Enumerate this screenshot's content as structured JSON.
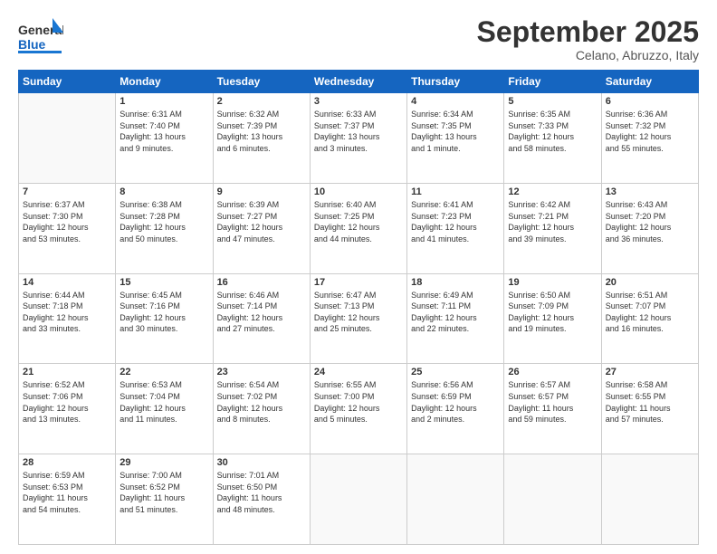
{
  "header": {
    "logo_general": "General",
    "logo_blue": "Blue",
    "month_title": "September 2025",
    "location": "Celano, Abruzzo, Italy"
  },
  "days_of_week": [
    "Sunday",
    "Monday",
    "Tuesday",
    "Wednesday",
    "Thursday",
    "Friday",
    "Saturday"
  ],
  "weeks": [
    [
      {
        "day": "",
        "info": ""
      },
      {
        "day": "1",
        "info": "Sunrise: 6:31 AM\nSunset: 7:40 PM\nDaylight: 13 hours\nand 9 minutes."
      },
      {
        "day": "2",
        "info": "Sunrise: 6:32 AM\nSunset: 7:39 PM\nDaylight: 13 hours\nand 6 minutes."
      },
      {
        "day": "3",
        "info": "Sunrise: 6:33 AM\nSunset: 7:37 PM\nDaylight: 13 hours\nand 3 minutes."
      },
      {
        "day": "4",
        "info": "Sunrise: 6:34 AM\nSunset: 7:35 PM\nDaylight: 13 hours\nand 1 minute."
      },
      {
        "day": "5",
        "info": "Sunrise: 6:35 AM\nSunset: 7:33 PM\nDaylight: 12 hours\nand 58 minutes."
      },
      {
        "day": "6",
        "info": "Sunrise: 6:36 AM\nSunset: 7:32 PM\nDaylight: 12 hours\nand 55 minutes."
      }
    ],
    [
      {
        "day": "7",
        "info": "Sunrise: 6:37 AM\nSunset: 7:30 PM\nDaylight: 12 hours\nand 53 minutes."
      },
      {
        "day": "8",
        "info": "Sunrise: 6:38 AM\nSunset: 7:28 PM\nDaylight: 12 hours\nand 50 minutes."
      },
      {
        "day": "9",
        "info": "Sunrise: 6:39 AM\nSunset: 7:27 PM\nDaylight: 12 hours\nand 47 minutes."
      },
      {
        "day": "10",
        "info": "Sunrise: 6:40 AM\nSunset: 7:25 PM\nDaylight: 12 hours\nand 44 minutes."
      },
      {
        "day": "11",
        "info": "Sunrise: 6:41 AM\nSunset: 7:23 PM\nDaylight: 12 hours\nand 41 minutes."
      },
      {
        "day": "12",
        "info": "Sunrise: 6:42 AM\nSunset: 7:21 PM\nDaylight: 12 hours\nand 39 minutes."
      },
      {
        "day": "13",
        "info": "Sunrise: 6:43 AM\nSunset: 7:20 PM\nDaylight: 12 hours\nand 36 minutes."
      }
    ],
    [
      {
        "day": "14",
        "info": "Sunrise: 6:44 AM\nSunset: 7:18 PM\nDaylight: 12 hours\nand 33 minutes."
      },
      {
        "day": "15",
        "info": "Sunrise: 6:45 AM\nSunset: 7:16 PM\nDaylight: 12 hours\nand 30 minutes."
      },
      {
        "day": "16",
        "info": "Sunrise: 6:46 AM\nSunset: 7:14 PM\nDaylight: 12 hours\nand 27 minutes."
      },
      {
        "day": "17",
        "info": "Sunrise: 6:47 AM\nSunset: 7:13 PM\nDaylight: 12 hours\nand 25 minutes."
      },
      {
        "day": "18",
        "info": "Sunrise: 6:49 AM\nSunset: 7:11 PM\nDaylight: 12 hours\nand 22 minutes."
      },
      {
        "day": "19",
        "info": "Sunrise: 6:50 AM\nSunset: 7:09 PM\nDaylight: 12 hours\nand 19 minutes."
      },
      {
        "day": "20",
        "info": "Sunrise: 6:51 AM\nSunset: 7:07 PM\nDaylight: 12 hours\nand 16 minutes."
      }
    ],
    [
      {
        "day": "21",
        "info": "Sunrise: 6:52 AM\nSunset: 7:06 PM\nDaylight: 12 hours\nand 13 minutes."
      },
      {
        "day": "22",
        "info": "Sunrise: 6:53 AM\nSunset: 7:04 PM\nDaylight: 12 hours\nand 11 minutes."
      },
      {
        "day": "23",
        "info": "Sunrise: 6:54 AM\nSunset: 7:02 PM\nDaylight: 12 hours\nand 8 minutes."
      },
      {
        "day": "24",
        "info": "Sunrise: 6:55 AM\nSunset: 7:00 PM\nDaylight: 12 hours\nand 5 minutes."
      },
      {
        "day": "25",
        "info": "Sunrise: 6:56 AM\nSunset: 6:59 PM\nDaylight: 12 hours\nand 2 minutes."
      },
      {
        "day": "26",
        "info": "Sunrise: 6:57 AM\nSunset: 6:57 PM\nDaylight: 11 hours\nand 59 minutes."
      },
      {
        "day": "27",
        "info": "Sunrise: 6:58 AM\nSunset: 6:55 PM\nDaylight: 11 hours\nand 57 minutes."
      }
    ],
    [
      {
        "day": "28",
        "info": "Sunrise: 6:59 AM\nSunset: 6:53 PM\nDaylight: 11 hours\nand 54 minutes."
      },
      {
        "day": "29",
        "info": "Sunrise: 7:00 AM\nSunset: 6:52 PM\nDaylight: 11 hours\nand 51 minutes."
      },
      {
        "day": "30",
        "info": "Sunrise: 7:01 AM\nSunset: 6:50 PM\nDaylight: 11 hours\nand 48 minutes."
      },
      {
        "day": "",
        "info": ""
      },
      {
        "day": "",
        "info": ""
      },
      {
        "day": "",
        "info": ""
      },
      {
        "day": "",
        "info": ""
      }
    ]
  ]
}
